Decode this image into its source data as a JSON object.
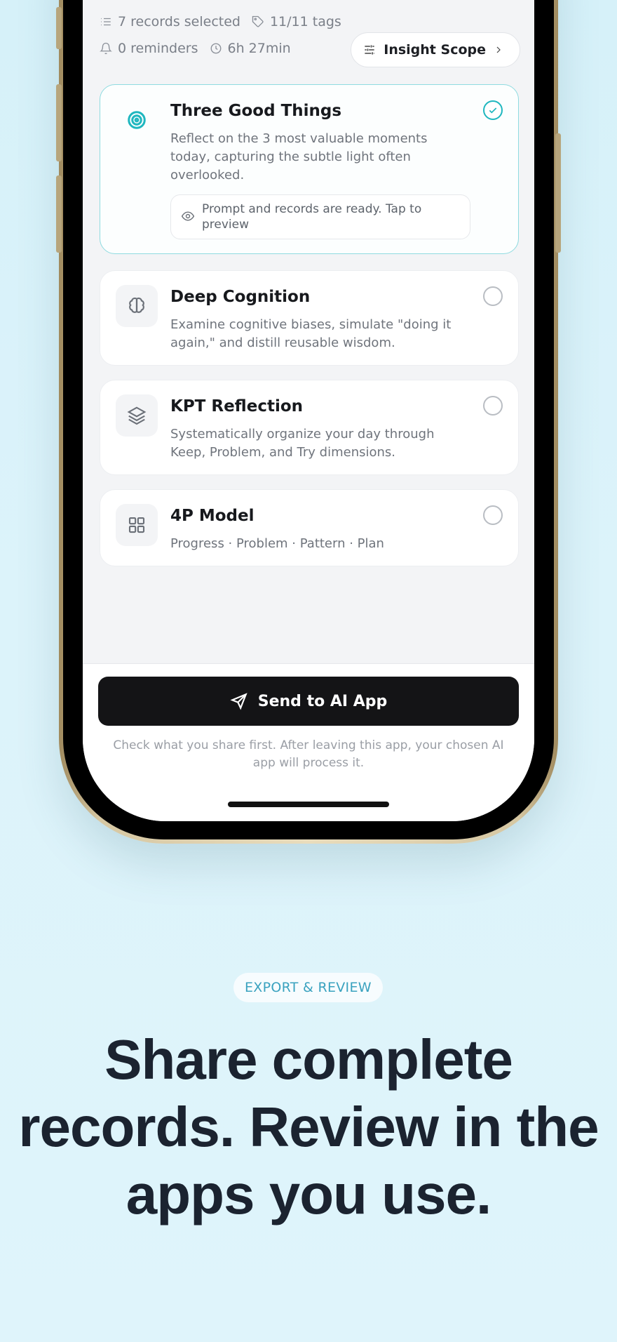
{
  "header": {
    "records_selected": "7 records selected",
    "tags": "11/11 tags",
    "reminders": "0 reminders",
    "duration": "6h 27min",
    "scope_button": "Insight Scope"
  },
  "templates": [
    {
      "title": "Three Good Things",
      "description": "Reflect on the 3 most valuable moments today, capturing the subtle light often overlooked.",
      "icon": "target-icon",
      "selected": true,
      "preview": "Prompt and records are ready. Tap to preview"
    },
    {
      "title": "Deep Cognition",
      "description": "Examine cognitive biases, simulate \"doing it again,\" and distill reusable wisdom.",
      "icon": "brain-icon",
      "selected": false
    },
    {
      "title": "KPT Reflection",
      "description": "Systematically organize your day through Keep, Problem, and Try dimensions.",
      "icon": "layers-icon",
      "selected": false
    },
    {
      "title": "4P Model",
      "description": "Progress · Problem · Pattern · Plan",
      "icon": "grid-icon",
      "selected": false
    }
  ],
  "footer": {
    "send_button": "Send to AI App",
    "note": "Check what you share first. After leaving this app, your chosen AI app will process it."
  },
  "marketing": {
    "badge": "EXPORT & REVIEW",
    "headline": "Share complete records. Review in the apps you use."
  },
  "colors": {
    "accent": "#1fb7bf",
    "send_button_bg": "#141416",
    "background": "#dcf3fa",
    "headline": "#1b2330"
  }
}
